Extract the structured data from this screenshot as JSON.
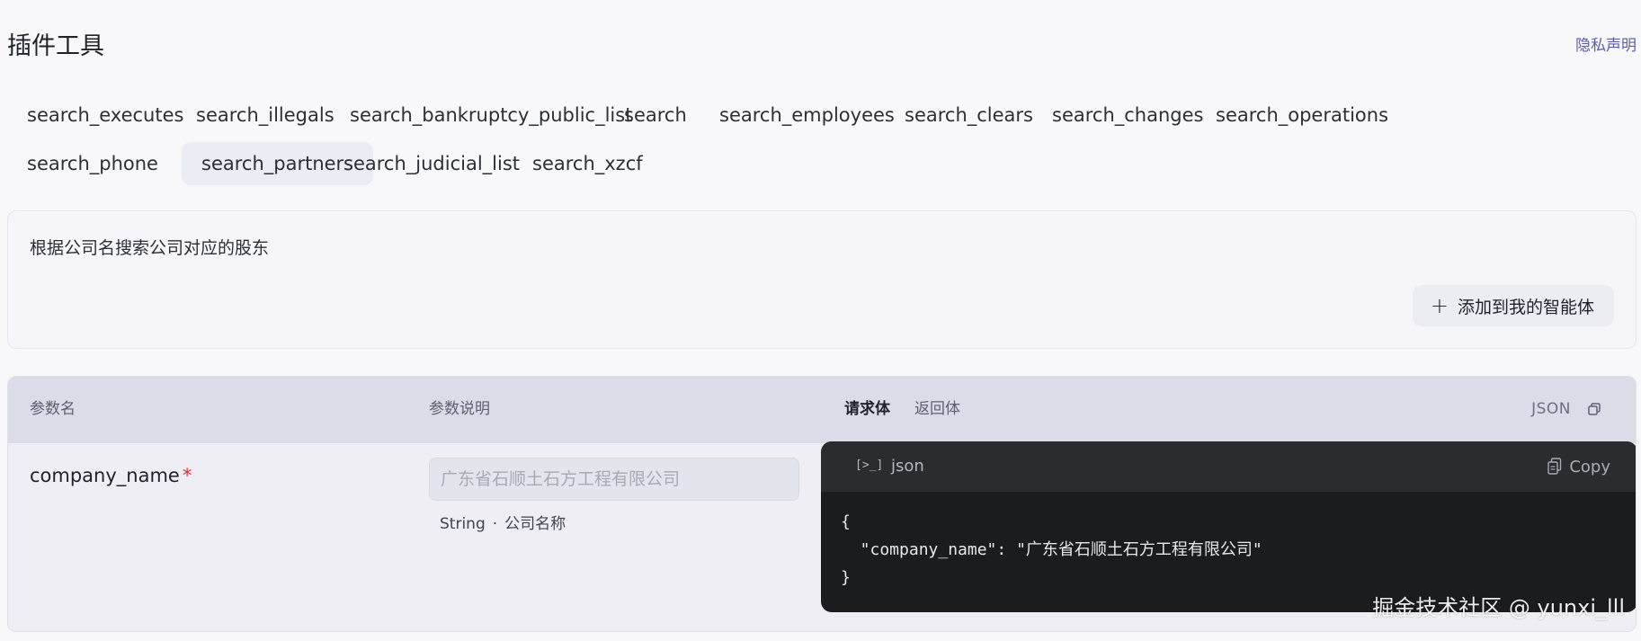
{
  "header": {
    "title": "插件工具",
    "privacy_link": "隐私声明"
  },
  "tabs": [
    {
      "label": "search_executes",
      "active": false
    },
    {
      "label": "search_illegals",
      "active": false
    },
    {
      "label": "search_bankruptcy_public_list",
      "active": false
    },
    {
      "label": "search",
      "active": false
    },
    {
      "label": "search_employees",
      "active": false
    },
    {
      "label": "search_clears",
      "active": false
    },
    {
      "label": "search_changes",
      "active": false
    },
    {
      "label": "search_operations",
      "active": false
    },
    {
      "label": "search_phone",
      "active": false
    },
    {
      "label": "search_partners",
      "active": true
    },
    {
      "label": "search_judicial_list",
      "active": false
    },
    {
      "label": "search_xzcf",
      "active": false
    }
  ],
  "description": {
    "text": "根据公司名搜索公司对应的股东",
    "add_button_label": "添加到我的智能体",
    "add_button_icon": "plus-icon"
  },
  "params_table": {
    "col_name": "参数名",
    "col_desc": "参数说明",
    "code_tabs": [
      "请求体",
      "返回体"
    ],
    "active_code_tab": "请求体",
    "format_label": "JSON",
    "rows": [
      {
        "name": "company_name",
        "required_mark": "*",
        "placeholder": "广东省石顺土石方工程有限公司",
        "type": "String",
        "separator": "·",
        "description": "公司名称"
      }
    ]
  },
  "code_block": {
    "terminal_icon": "[>_]",
    "language": "json",
    "copy_label": "Copy",
    "lines": [
      "{",
      "  \"company_name\": \"广东省石顺土石方工程有限公司\"",
      "}"
    ]
  },
  "watermark": "掘金技术社区 @ yunxi_lll",
  "colors": {
    "page_bg": "#f8f8fb",
    "active_tab_bg": "#ececf4",
    "table_header_bg": "#dcdce8",
    "code_bg": "#1b1c1e",
    "code_header_bg": "#2a2c30",
    "required": "#e0303b",
    "link": "#5a5fa8"
  }
}
